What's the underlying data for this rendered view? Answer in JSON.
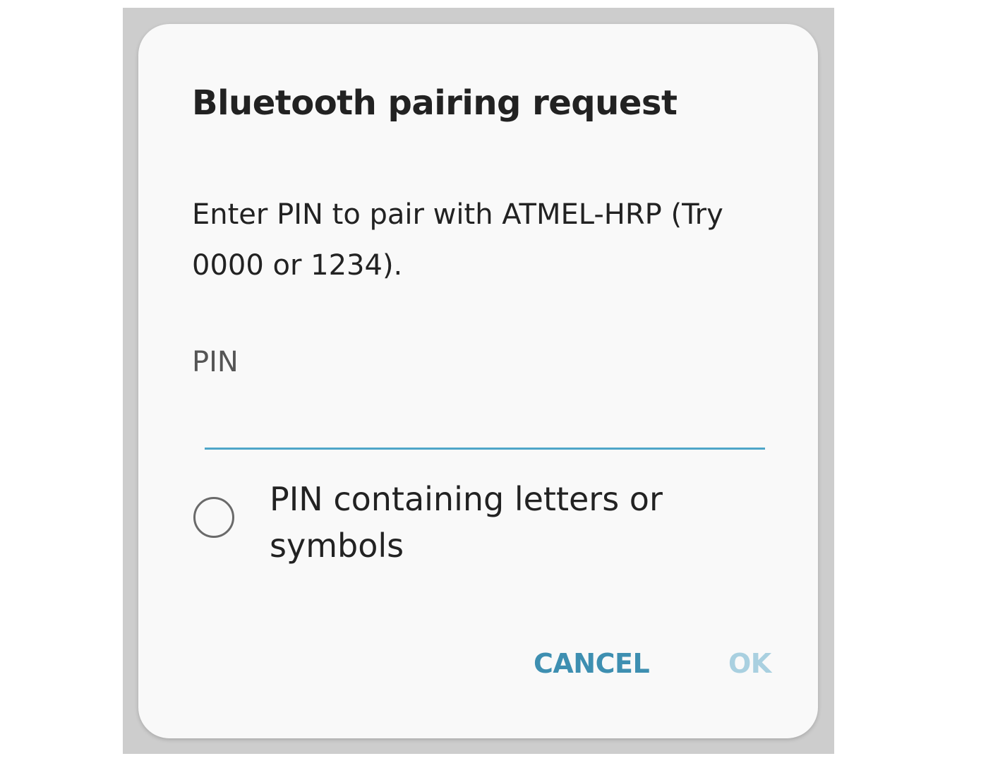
{
  "dialog": {
    "title": "Bluetooth pairing request",
    "message": "Enter PIN to pair with ATMEL-HRP (Try 0000 or 1234).",
    "pin_label": "PIN",
    "pin_value": "",
    "checkbox_label": "PIN containing letters or symbols",
    "cancel_label": "CANCEL",
    "ok_label": "OK"
  },
  "colors": {
    "accent": "#3e8fb1",
    "accent_disabled": "#a9d0e0",
    "underline": "#4ea6c9",
    "dialog_background": "#f9f9f9",
    "backdrop": "#cdcdcd"
  }
}
